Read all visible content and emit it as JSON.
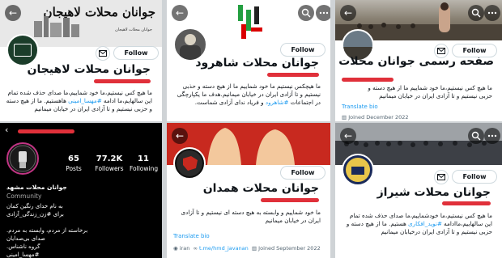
{
  "follow_label": "Follow",
  "translate_label": "Translate bio",
  "panels": {
    "lahijan": {
      "banner_text": "جوانان محلات لاهیجان",
      "banner_sub": "جوانان محلات لاهیجان",
      "name": "جوانان محلات لاهیجان",
      "bio_line1": "ما هیچ کس نیستیم،ما خود شماییم،ما صدای حذف شده تمام",
      "bio_line2_a": "این سالهایم،ما ادامه ",
      "bio_tag": "#مهسا_امینی",
      "bio_line2_b": " هاهستیم. ما از هیچ دسته",
      "bio_line3": "و حزبی نیستیم و تا آزادی ایران در خیابان میمانیم"
    },
    "shahrood": {
      "name": "جوانان محلات شاهرود",
      "bio_line1": "ما هیچکس نیستیم ما خود شماییم ما از هیچ دسته و حذبی",
      "bio_line2": "نیستیم و تا آزادی ایران در خیابان میمانیم.هدف ما یکپارچگی",
      "bio_line3_a": "در اجتماعات ",
      "bio_tag": "#شاهرود",
      "bio_line3_b": " و فریاد ندای آزادی شماست."
    },
    "qom": {
      "name": "صفحه رسمی جوانان محلات قم",
      "bio_line1": "ما هیچ کس نیستیم،ما خود شماییم ما از هیچ دسته و",
      "bio_line2": "حزبی نیستیم و تا آزادی ایران در خیابان میمانیم",
      "joined": "Joined December 2022"
    },
    "mashhad": {
      "posts_count": "65",
      "posts_label": "Posts",
      "followers_count": "77.2K",
      "followers_label": "Followers",
      "following_count": "11",
      "following_label": "Following",
      "name": "جوانان محلات مشهد",
      "category": "Community",
      "bio_line1": "به نام خدای رنگین کمان",
      "bio_line2": "برای #زن_زندگی_آزادی",
      "bio_line3": "برخاسته از مردم، وابسته به مردم.",
      "bio_line4": "صدای بی‌صدایان",
      "bio_line5": "گروه ناشناس.",
      "bio_line6": "#مهسا_امینی"
    },
    "hamedan": {
      "name": "جوانان محلات همدان",
      "bio_line1": "ما خود شماییم و وابسته به هیچ دسته ای نیستیم و تا آزادی",
      "bio_line2": "ایران در خیابان میمانیم",
      "location": "iran",
      "website": "t.me/hmd_javanan",
      "joined": "Joined September 2022"
    },
    "shiraz": {
      "name": "جوانان محلات شیراز",
      "bio_line1": "ما هیچ کس نیستیم،ما خودشماییم،ما صدای حذف شده تمام",
      "bio_line2_a": "این سالهاییم،ماادامه ",
      "bio_tag": "#نوید_افکاری",
      "bio_line2_b": " هستیم. ما از هیچ دسته و",
      "bio_line3": "حزبی نیستیم و تا آزادی ایران درخیابان میمانیم"
    }
  },
  "colors": {
    "accent": "#1d9bf0",
    "redact": "#e0303a",
    "hamedan_banner": "#c8291f"
  }
}
